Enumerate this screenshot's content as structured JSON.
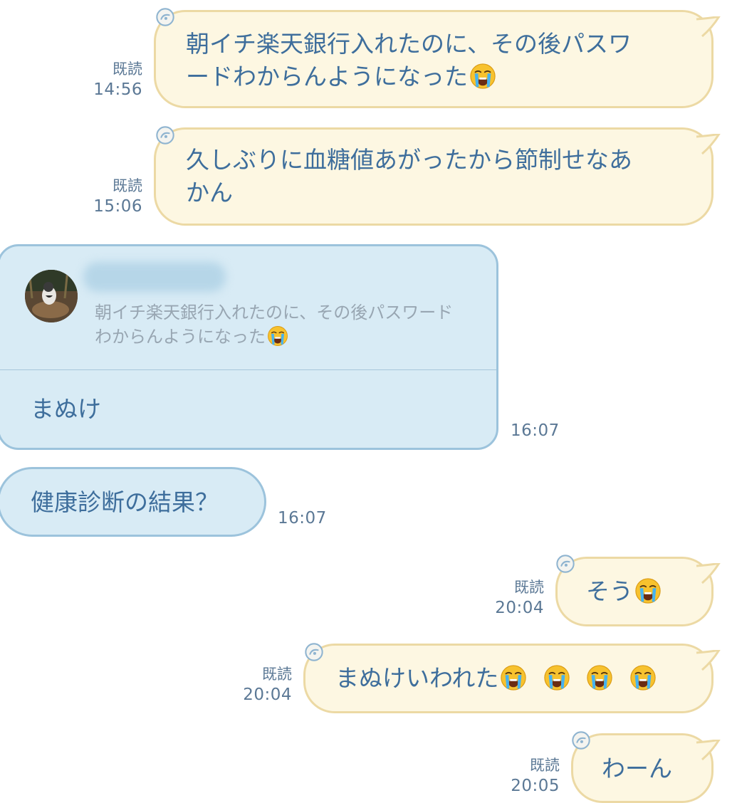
{
  "messages": {
    "m1": {
      "line1": "朝イチ楽天銀行入れたのに、その後パスワ",
      "line2": "ードわからんようになった",
      "emoji": "crying-face",
      "read": "既読",
      "time": "14:56"
    },
    "m2": {
      "line1": "久しぶりに血糖値あがったから節制せなあ",
      "line2": "かん",
      "read": "既読",
      "time": "15:06"
    },
    "m3": {
      "quote_line1": "朝イチ楽天銀行入れたのに、その後パスワード",
      "quote_line2": "わからんようになった",
      "quote_emoji": "crying-face",
      "reply": "まぬけ",
      "time": "16:07"
    },
    "m4": {
      "text": "健康診断の結果？",
      "time": "16:07"
    },
    "m5": {
      "text": "そう",
      "emoji": "crying-face",
      "read": "既読",
      "time": "20:04"
    },
    "m6": {
      "text": "まぬけいわれた",
      "emoji_count": 4,
      "emoji": "crying-face",
      "read": "既読",
      "time": "20:04"
    },
    "m7": {
      "text": "わーん",
      "read": "既読",
      "time": "20:05"
    }
  },
  "colors": {
    "outgoing_bg": "#fdf7e2",
    "outgoing_border": "#ecd9a4",
    "incoming_bg": "#d8ebf5",
    "incoming_border": "#9cc3dc",
    "text": "#3e6e9c",
    "meta": "#5b7895"
  }
}
